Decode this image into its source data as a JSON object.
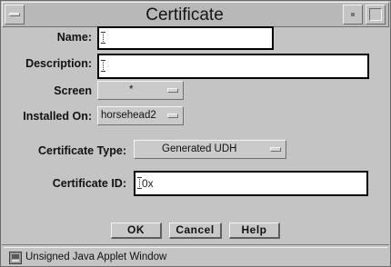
{
  "window": {
    "title": "Certificate"
  },
  "form": {
    "name_label": "Name:",
    "name_value": "",
    "description_label": "Description:",
    "description_value": "",
    "screen_label": "Screen",
    "screen_value": "*",
    "installed_on_label": "Installed On:",
    "installed_on_value": "horsehead2",
    "certificate_type_label": "Certificate Type:",
    "certificate_type_value": "Generated UDH",
    "certificate_id_label": "Certificate ID:",
    "certificate_id_value": "0x"
  },
  "buttons": {
    "ok": "OK",
    "cancel": "Cancel",
    "help": "Help"
  },
  "status_bar": {
    "text": "Unsigned Java Applet Window",
    "icon": "java-coffee-cup-icon"
  }
}
